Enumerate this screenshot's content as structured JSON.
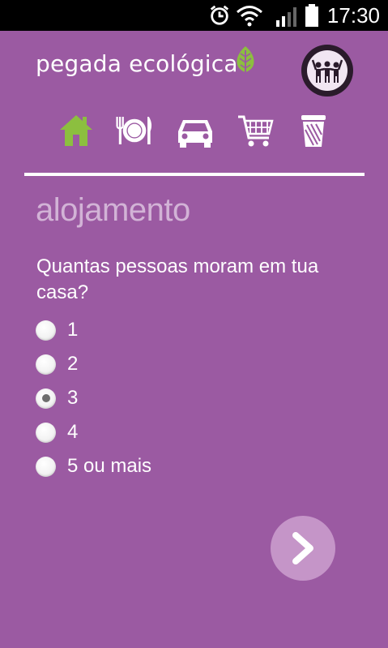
{
  "status_bar": {
    "time": "17:30",
    "icons": [
      "alarm-icon",
      "wifi-icon",
      "signal-icon",
      "battery-icon"
    ]
  },
  "header": {
    "brand": "pegada ecológica",
    "brand_icon": "leaf-icon",
    "avatar_icon": "people-icon"
  },
  "nav": {
    "items": [
      {
        "icon": "home-icon",
        "active": true
      },
      {
        "icon": "food-icon",
        "active": false
      },
      {
        "icon": "car-icon",
        "active": false
      },
      {
        "icon": "cart-icon",
        "active": false
      },
      {
        "icon": "trash-icon",
        "active": false
      }
    ]
  },
  "section": {
    "title": "alojamento",
    "question": "Quantas pessoas moram em tua casa?"
  },
  "options": [
    {
      "label": "1",
      "selected": false
    },
    {
      "label": "2",
      "selected": false
    },
    {
      "label": "3",
      "selected": true
    },
    {
      "label": "4",
      "selected": false
    },
    {
      "label": "5 ou mais",
      "selected": false
    }
  ],
  "next_button": {
    "icon": "chevron-right-icon"
  },
  "colors": {
    "background": "#9b5aa2",
    "accent_green": "#8cbf3f",
    "title": "#d2b3d6",
    "next_button": "#c595c8"
  }
}
